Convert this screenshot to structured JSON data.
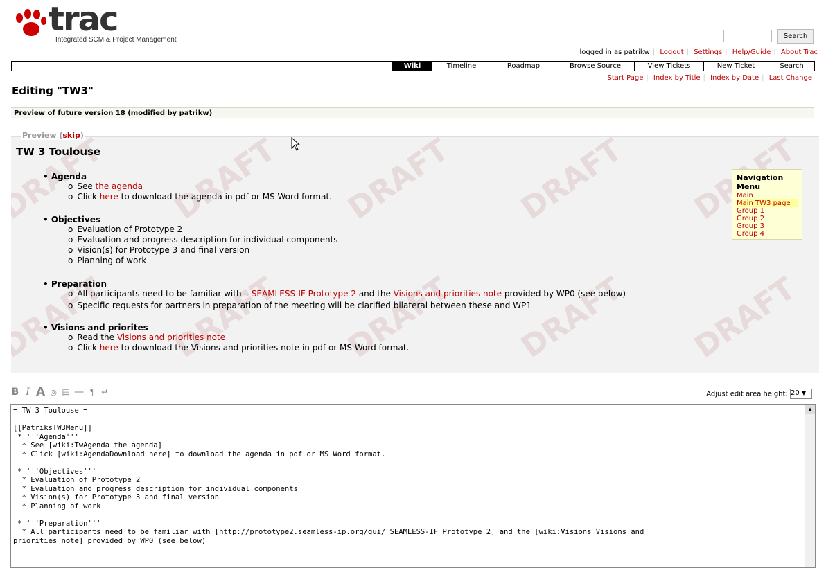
{
  "header": {
    "logo_word": "trac",
    "tagline": "Integrated SCM & Project Management",
    "search_button": "Search"
  },
  "metanav": {
    "logged_in": "logged in as patrikw",
    "items": [
      "Logout",
      "Settings",
      "Help/Guide",
      "About Trac"
    ]
  },
  "mainnav": {
    "tabs": [
      "Wiki",
      "Timeline",
      "Roadmap",
      "Browse Source",
      "View Tickets",
      "New Ticket",
      "Search"
    ],
    "active": "Wiki"
  },
  "ctxtnav": {
    "items": [
      "Start Page",
      "Index by Title",
      "Index by Date",
      "Last Change"
    ]
  },
  "page_title": "Editing \"TW3\"",
  "preview_banner": "Preview of future version 18 (modified by patrikw)",
  "preview": {
    "legend": "Preview (",
    "legend_skip": "skip",
    "legend_close": ")",
    "watermark": "DRAFT",
    "title": "TW 3 Toulouse",
    "sections": [
      {
        "head": "Agenda"
      },
      {
        "head": "Objectives"
      },
      {
        "head": "Preparation"
      },
      {
        "head": "Visions and priorites"
      }
    ],
    "agenda": {
      "l1a": "See ",
      "l1link": "the agenda",
      "l2a": "Click ",
      "l2link": "here",
      "l2b": " to download the agenda in pdf or MS Word format."
    },
    "objectives": [
      "Evaluation of Prototype 2",
      "Evaluation and progress description for individual components",
      "Vision(s) for Prototype 3 and final version",
      "Planning of work"
    ],
    "preparation": {
      "l1a": "All participants need to be familiar with ",
      "l1link1": "SEAMLESS-IF Prototype 2",
      "l1b": " and the ",
      "l1link2": "Visions and priorities note",
      "l1c": " provided by WP0 (see below)",
      "l2": "Specific requests for partners in preparation of the meeting will be clarified bilateral between these and WP1"
    },
    "visions": {
      "l1a": "Read the ",
      "l1link": "Visions and priorities note",
      "l2a": "Click ",
      "l2link": "here",
      "l2b": " to download the Visions and priorities note in pdf or MS Word format."
    }
  },
  "navmenu": {
    "title": "Navigation Menu",
    "items": [
      "Main",
      "Main TW3 page",
      "Group 1",
      "Group 2",
      "Group 3",
      "Group 4"
    ]
  },
  "toolbar": {
    "bold": "B",
    "italic": "I",
    "heading": "A",
    "link": "◎",
    "code": "▤",
    "hr": "—",
    "paragraph": "¶",
    "linebreak": "↵"
  },
  "adjust": {
    "label": "Adjust edit area height:",
    "value": "20"
  },
  "editor": {
    "text": "= TW 3 Toulouse =\n\n[[PatriksTW3Menu]]\n * '''Agenda'''\n  * See [wiki:TwAgenda the agenda]\n  * Click [wiki:AgendaDownload here] to download the agenda in pdf or MS Word format.\n\n * '''Objectives'''\n  * Evaluation of Prototype 2\n  * Evaluation and progress description for individual components\n  * Vision(s) for Prototype 3 and final version\n  * Planning of work\n\n * '''Preparation'''\n  * All participants need to be familiar with [http://prototype2.seamless-ip.org/gui/ SEAMLESS-IF Prototype 2] and the [wiki:Visions Visions and\npriorities note] provided by WP0 (see below)"
  },
  "colors": {
    "link": "#bb0000",
    "nav_active_bg": "#000000",
    "preview_bg": "#f2f2f2",
    "navmenu_bg": "#ffffd6"
  }
}
